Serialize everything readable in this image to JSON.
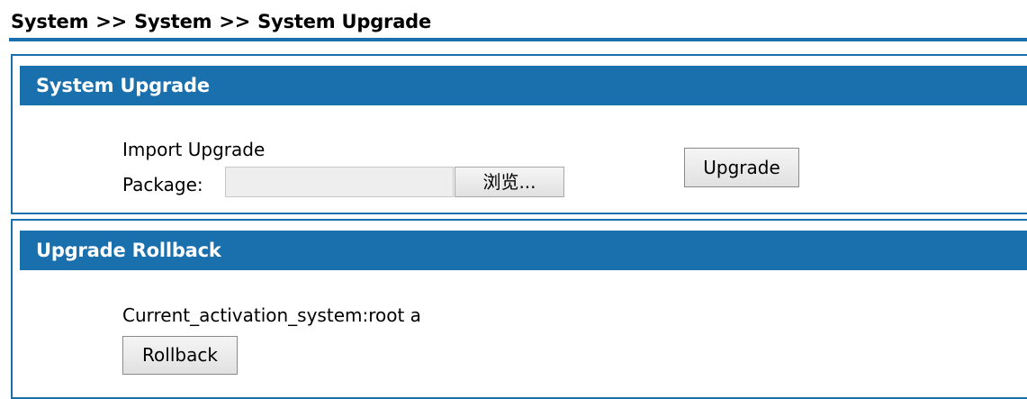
{
  "breadcrumb": {
    "items": [
      "System",
      "System",
      "System Upgrade"
    ],
    "separator": ">>"
  },
  "upgrade_panel": {
    "title": "System Upgrade",
    "import_label_line1": "Import Upgrade",
    "import_label_line2": "Package:",
    "browse_label": "浏览...",
    "upgrade_button": "Upgrade"
  },
  "rollback_panel": {
    "title": "Upgrade Rollback",
    "current_system_text": "Current_activation_system:root a",
    "rollback_button": "Rollback"
  },
  "colors": {
    "accent": "#1a6fad",
    "header_text": "#ffffff"
  }
}
